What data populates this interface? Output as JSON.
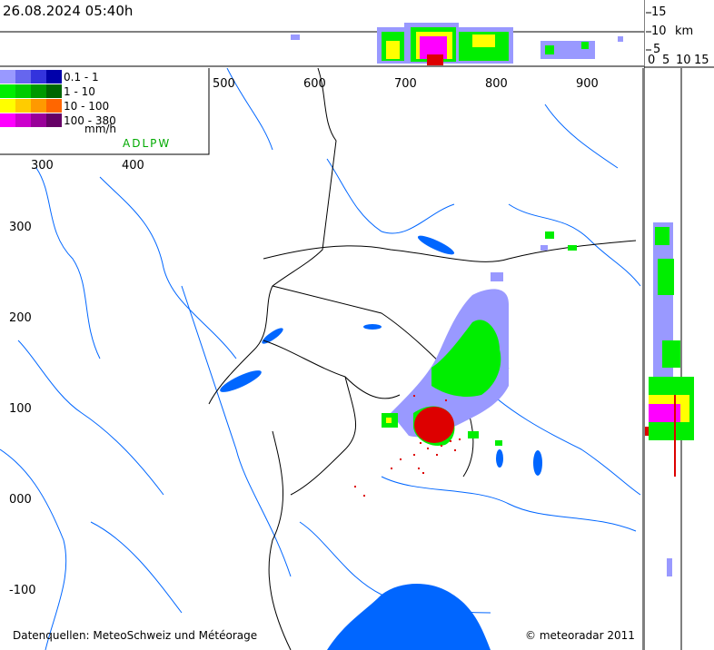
{
  "timestamp": "26.08.2024 05:40h",
  "legend": {
    "rows": [
      {
        "label": "0.1 -    1",
        "colors": [
          "#9999ff",
          "#6666ee",
          "#3333dd",
          "#0000aa"
        ]
      },
      {
        "label": "   1 -   10",
        "colors": [
          "#00ee00",
          "#00cc00",
          "#009900",
          "#006600"
        ]
      },
      {
        "label": "  10 - 100",
        "colors": [
          "#ffff00",
          "#ffcc00",
          "#ff9900",
          "#ff6600"
        ]
      },
      {
        "label": "100 - 380",
        "colors": [
          "#ff00ff",
          "#cc00cc",
          "#990099",
          "#660066"
        ]
      }
    ],
    "unit": "mm/h",
    "station_code": "ADLPW"
  },
  "x_ticks_top": [
    "500",
    "600",
    "700",
    "800",
    "900"
  ],
  "x_ticks_inner": [
    "300",
    "400"
  ],
  "y_ticks": [
    "300",
    "200",
    "100",
    "000",
    "-100"
  ],
  "height_profile": {
    "right_ticks": [
      "15",
      "10",
      "5"
    ],
    "unit": "km",
    "bottom_ticks": [
      "0",
      "5",
      "10",
      "15"
    ]
  },
  "footer": {
    "sources": "Datenquellen: MeteoSchweiz und Météorage",
    "copyright": "© meteoradar 2011"
  },
  "colors": {
    "river": "#0066ff",
    "lake": "#0066ff",
    "border": "#000000",
    "rain_light": "#9999ff",
    "rain_mid": "#00ee00",
    "rain_heavy": "#ffff00",
    "rain_extreme": "#ff00ff",
    "lightning": "#dd0000"
  }
}
